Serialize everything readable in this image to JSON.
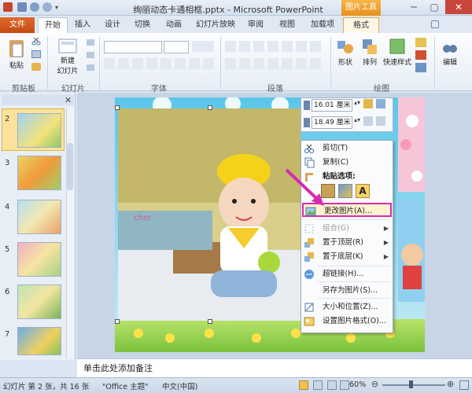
{
  "window": {
    "title": "绚丽动态卡通相框.pptx - Microsoft PowerPoint",
    "picture_tools_label": "图片工具"
  },
  "tabs": [
    "文件",
    "开始",
    "插入",
    "设计",
    "切换",
    "动画",
    "幻灯片放映",
    "审阅",
    "视图",
    "加载项",
    "格式"
  ],
  "ribbon": {
    "clipboard": {
      "paste": "粘贴",
      "group": "剪贴板"
    },
    "slides": {
      "new_slide": "新建\n幻灯片",
      "group": "幻灯片"
    },
    "font": {
      "group": "字体"
    },
    "paragraph": {
      "group": "段落"
    },
    "drawing": {
      "shape": "形状",
      "arrange": "排列",
      "quick_styles": "快速样式",
      "group": "绘图"
    },
    "editing": {
      "edit": "编辑"
    }
  },
  "slides_pane": {
    "numbers": [
      "2",
      "3",
      "4",
      "5",
      "6",
      "7"
    ],
    "selected": "2"
  },
  "size_toolbar": {
    "height_value": "16.01 厘米",
    "width_value": "18.49 厘米"
  },
  "context_menu": {
    "items": [
      {
        "label": "剪切(T)",
        "icon": "scissors-icon"
      },
      {
        "label": "复制(C)",
        "icon": "copy-icon"
      },
      {
        "label": "粘贴选项:",
        "icon": "paste-icon"
      },
      {
        "label": "更改图片(A)...",
        "icon": "change-picture-icon"
      },
      {
        "label": "组合(G)",
        "icon": "group-icon"
      },
      {
        "label": "置于顶层(R)",
        "icon": "bring-front-icon"
      },
      {
        "label": "置于底层(K)",
        "icon": "send-back-icon"
      },
      {
        "label": "超链接(H)...",
        "icon": "hyperlink-icon"
      },
      {
        "label": "另存为图片(S)...",
        "icon": "save-picture-icon"
      },
      {
        "label": "大小和位置(Z)...",
        "icon": "size-icon"
      },
      {
        "label": "设置图片格式(O)...",
        "icon": "format-picture-icon"
      }
    ],
    "paste_option_a": "A"
  },
  "photo": {
    "shirt_text": "cher"
  },
  "notes": {
    "placeholder": "单击此处添加备注"
  },
  "status": {
    "slide_info": "幻灯片 第 2 张，共 16 张",
    "theme": "\"Office 主题\"",
    "language": "中文(中国)",
    "zoom": "60%"
  },
  "colors": {
    "accent_file": "#d35a20",
    "picture_tools": "#f0a830",
    "highlight": "#d62cae"
  }
}
